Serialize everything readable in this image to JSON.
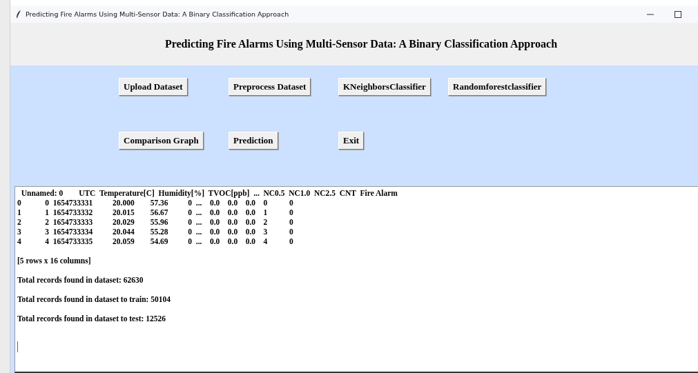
{
  "window": {
    "title": "Predicting Fire Alarms Using Multi-Sensor Data: A Binary Classification Approach"
  },
  "heading": "Predicting Fire Alarms Using Multi-Sensor Data: A Binary Classification Approach",
  "button_rows": [
    [
      "Upload Dataset",
      "Preprocess Dataset",
      "KNeighborsClassifier",
      "Randomforestclassifier"
    ],
    [
      "Comparison Graph",
      "Prediction",
      "Exit"
    ]
  ],
  "output_lines": [
    "  Unnamed: 0        UTC  Temperature[C]  Humidity[%]  TVOC[ppb]  ...  NC0.5  NC1.0  NC2.5  CNT  Fire Alarm",
    "0            0  1654733331          20.000        57.36          0  ...    0.0    0.0    0.0    0           0",
    "1            1  1654733332          20.015        56.67          0  ...    0.0    0.0    0.0    1           0",
    "2            2  1654733333          20.029        55.96          0  ...    0.0    0.0    0.0    2           0",
    "3            3  1654733334          20.044        55.28          0  ...    0.0    0.0    0.0    3           0",
    "4            4  1654733335          20.059        54.69          0  ...    0.0    0.0    0.0    4           0",
    "[5 rows x 16 columns]",
    "Total records found in dataset: 62630",
    "Total records found in dataset to train: 50104",
    "Total records found in dataset to test: 12526"
  ]
}
